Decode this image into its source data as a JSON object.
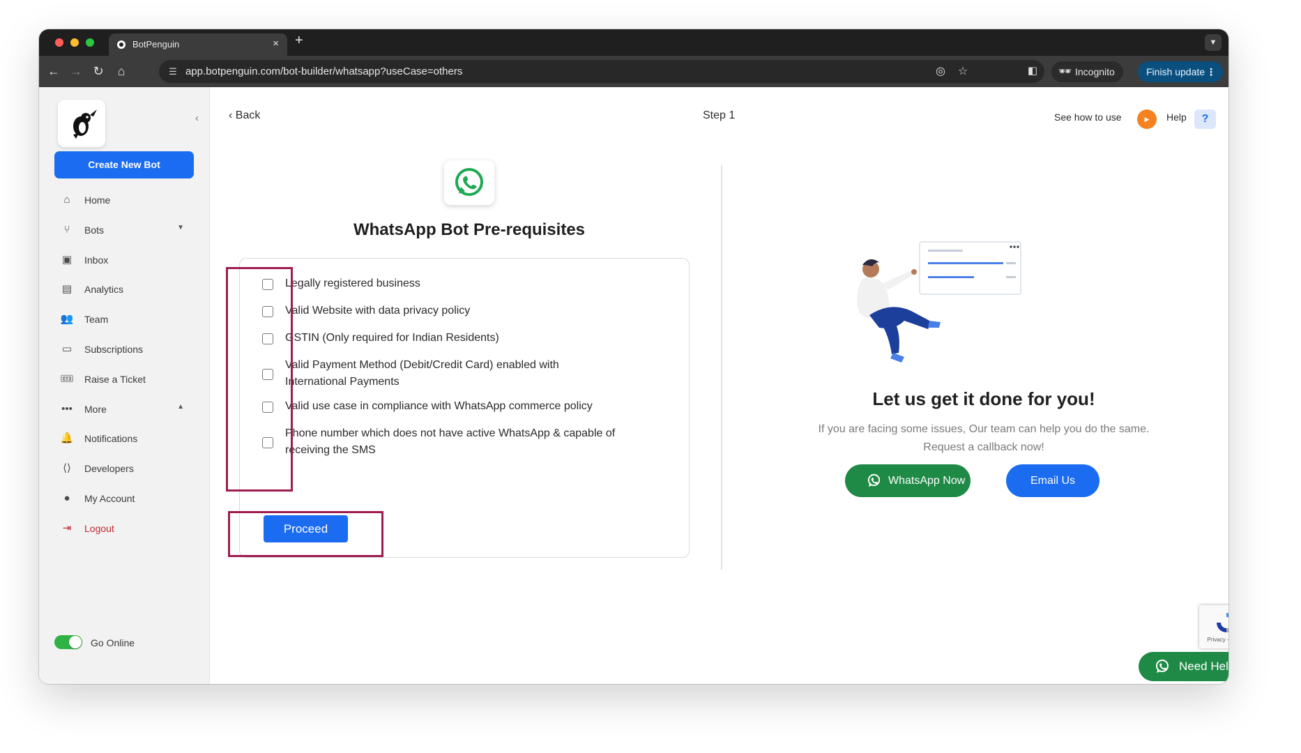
{
  "browser": {
    "tab_title": "BotPenguin",
    "tab_close": "×",
    "new_tab": "+",
    "url": "app.botpenguin.com/bot-builder/whatsapp?useCase=others",
    "incognito_label": "Incognito",
    "finish_update_label": "Finish update"
  },
  "sidebar": {
    "create_button": "Create New Bot",
    "items": [
      {
        "label": "Home",
        "icon": "home-icon"
      },
      {
        "label": "Bots",
        "icon": "bots-icon"
      },
      {
        "label": "Inbox",
        "icon": "inbox-icon"
      },
      {
        "label": "Analytics",
        "icon": "analytics-icon"
      },
      {
        "label": "Team",
        "icon": "team-icon"
      },
      {
        "label": "Subscriptions",
        "icon": "subscriptions-icon"
      },
      {
        "label": "Raise a Ticket",
        "icon": "ticket-icon"
      },
      {
        "label": "More",
        "icon": "more-icon"
      },
      {
        "label": "Notifications",
        "icon": "bell-icon"
      },
      {
        "label": "Developers",
        "icon": "code-icon"
      },
      {
        "label": "My Account",
        "icon": "account-icon"
      },
      {
        "label": "Logout",
        "icon": "logout-icon"
      }
    ],
    "go_online_label": "Go Online"
  },
  "header": {
    "back_label": "Back",
    "step_label": "Step 1",
    "see_how_label": "See how to use",
    "help_label": "Help",
    "help_icon": "?"
  },
  "prerequisites": {
    "title": "WhatsApp Bot Pre-requisites",
    "items": [
      "Legally registered business",
      "Valid Website with data privacy policy",
      "GSTIN (Only required for Indian Residents)",
      "Valid Payment Method (Debit/Credit Card) enabled with International Payments",
      "Valid use case in compliance with WhatsApp commerce policy",
      "Phone number which does not have active WhatsApp & capable of receiving the SMS"
    ],
    "proceed_label": "Proceed"
  },
  "help_panel": {
    "title": "Let us get it done for you!",
    "subtitle_line1": "If you are facing some issues, Our team can help you do the same.",
    "subtitle_line2": "Request a callback now!",
    "whatsapp_button": "WhatsApp Now",
    "email_button": "Email Us"
  },
  "recaptcha": {
    "label": "Privacy - Terms"
  },
  "need_help": {
    "label": "Need Help?",
    "close": "×"
  },
  "colors": {
    "primary": "#1b6cf0",
    "whatsapp_green": "#1e8a46",
    "highlight": "#9e1c4f",
    "logout": "#c0272d",
    "orange": "#f58220"
  }
}
